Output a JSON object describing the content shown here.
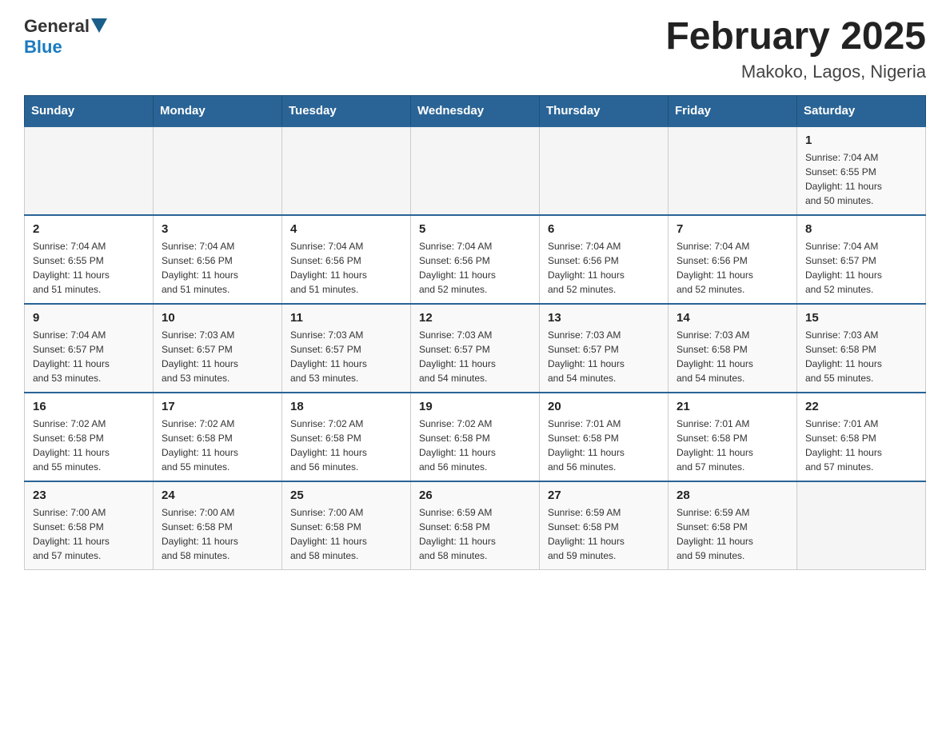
{
  "header": {
    "logo_general": "General",
    "logo_blue": "Blue",
    "title": "February 2025",
    "subtitle": "Makoko, Lagos, Nigeria"
  },
  "days_of_week": [
    "Sunday",
    "Monday",
    "Tuesday",
    "Wednesday",
    "Thursday",
    "Friday",
    "Saturday"
  ],
  "weeks": [
    {
      "days": [
        {
          "number": "",
          "info": ""
        },
        {
          "number": "",
          "info": ""
        },
        {
          "number": "",
          "info": ""
        },
        {
          "number": "",
          "info": ""
        },
        {
          "number": "",
          "info": ""
        },
        {
          "number": "",
          "info": ""
        },
        {
          "number": "1",
          "info": "Sunrise: 7:04 AM\nSunset: 6:55 PM\nDaylight: 11 hours\nand 50 minutes."
        }
      ]
    },
    {
      "days": [
        {
          "number": "2",
          "info": "Sunrise: 7:04 AM\nSunset: 6:55 PM\nDaylight: 11 hours\nand 51 minutes."
        },
        {
          "number": "3",
          "info": "Sunrise: 7:04 AM\nSunset: 6:56 PM\nDaylight: 11 hours\nand 51 minutes."
        },
        {
          "number": "4",
          "info": "Sunrise: 7:04 AM\nSunset: 6:56 PM\nDaylight: 11 hours\nand 51 minutes."
        },
        {
          "number": "5",
          "info": "Sunrise: 7:04 AM\nSunset: 6:56 PM\nDaylight: 11 hours\nand 52 minutes."
        },
        {
          "number": "6",
          "info": "Sunrise: 7:04 AM\nSunset: 6:56 PM\nDaylight: 11 hours\nand 52 minutes."
        },
        {
          "number": "7",
          "info": "Sunrise: 7:04 AM\nSunset: 6:56 PM\nDaylight: 11 hours\nand 52 minutes."
        },
        {
          "number": "8",
          "info": "Sunrise: 7:04 AM\nSunset: 6:57 PM\nDaylight: 11 hours\nand 52 minutes."
        }
      ]
    },
    {
      "days": [
        {
          "number": "9",
          "info": "Sunrise: 7:04 AM\nSunset: 6:57 PM\nDaylight: 11 hours\nand 53 minutes."
        },
        {
          "number": "10",
          "info": "Sunrise: 7:03 AM\nSunset: 6:57 PM\nDaylight: 11 hours\nand 53 minutes."
        },
        {
          "number": "11",
          "info": "Sunrise: 7:03 AM\nSunset: 6:57 PM\nDaylight: 11 hours\nand 53 minutes."
        },
        {
          "number": "12",
          "info": "Sunrise: 7:03 AM\nSunset: 6:57 PM\nDaylight: 11 hours\nand 54 minutes."
        },
        {
          "number": "13",
          "info": "Sunrise: 7:03 AM\nSunset: 6:57 PM\nDaylight: 11 hours\nand 54 minutes."
        },
        {
          "number": "14",
          "info": "Sunrise: 7:03 AM\nSunset: 6:58 PM\nDaylight: 11 hours\nand 54 minutes."
        },
        {
          "number": "15",
          "info": "Sunrise: 7:03 AM\nSunset: 6:58 PM\nDaylight: 11 hours\nand 55 minutes."
        }
      ]
    },
    {
      "days": [
        {
          "number": "16",
          "info": "Sunrise: 7:02 AM\nSunset: 6:58 PM\nDaylight: 11 hours\nand 55 minutes."
        },
        {
          "number": "17",
          "info": "Sunrise: 7:02 AM\nSunset: 6:58 PM\nDaylight: 11 hours\nand 55 minutes."
        },
        {
          "number": "18",
          "info": "Sunrise: 7:02 AM\nSunset: 6:58 PM\nDaylight: 11 hours\nand 56 minutes."
        },
        {
          "number": "19",
          "info": "Sunrise: 7:02 AM\nSunset: 6:58 PM\nDaylight: 11 hours\nand 56 minutes."
        },
        {
          "number": "20",
          "info": "Sunrise: 7:01 AM\nSunset: 6:58 PM\nDaylight: 11 hours\nand 56 minutes."
        },
        {
          "number": "21",
          "info": "Sunrise: 7:01 AM\nSunset: 6:58 PM\nDaylight: 11 hours\nand 57 minutes."
        },
        {
          "number": "22",
          "info": "Sunrise: 7:01 AM\nSunset: 6:58 PM\nDaylight: 11 hours\nand 57 minutes."
        }
      ]
    },
    {
      "days": [
        {
          "number": "23",
          "info": "Sunrise: 7:00 AM\nSunset: 6:58 PM\nDaylight: 11 hours\nand 57 minutes."
        },
        {
          "number": "24",
          "info": "Sunrise: 7:00 AM\nSunset: 6:58 PM\nDaylight: 11 hours\nand 58 minutes."
        },
        {
          "number": "25",
          "info": "Sunrise: 7:00 AM\nSunset: 6:58 PM\nDaylight: 11 hours\nand 58 minutes."
        },
        {
          "number": "26",
          "info": "Sunrise: 6:59 AM\nSunset: 6:58 PM\nDaylight: 11 hours\nand 58 minutes."
        },
        {
          "number": "27",
          "info": "Sunrise: 6:59 AM\nSunset: 6:58 PM\nDaylight: 11 hours\nand 59 minutes."
        },
        {
          "number": "28",
          "info": "Sunrise: 6:59 AM\nSunset: 6:58 PM\nDaylight: 11 hours\nand 59 minutes."
        },
        {
          "number": "",
          "info": ""
        }
      ]
    }
  ]
}
